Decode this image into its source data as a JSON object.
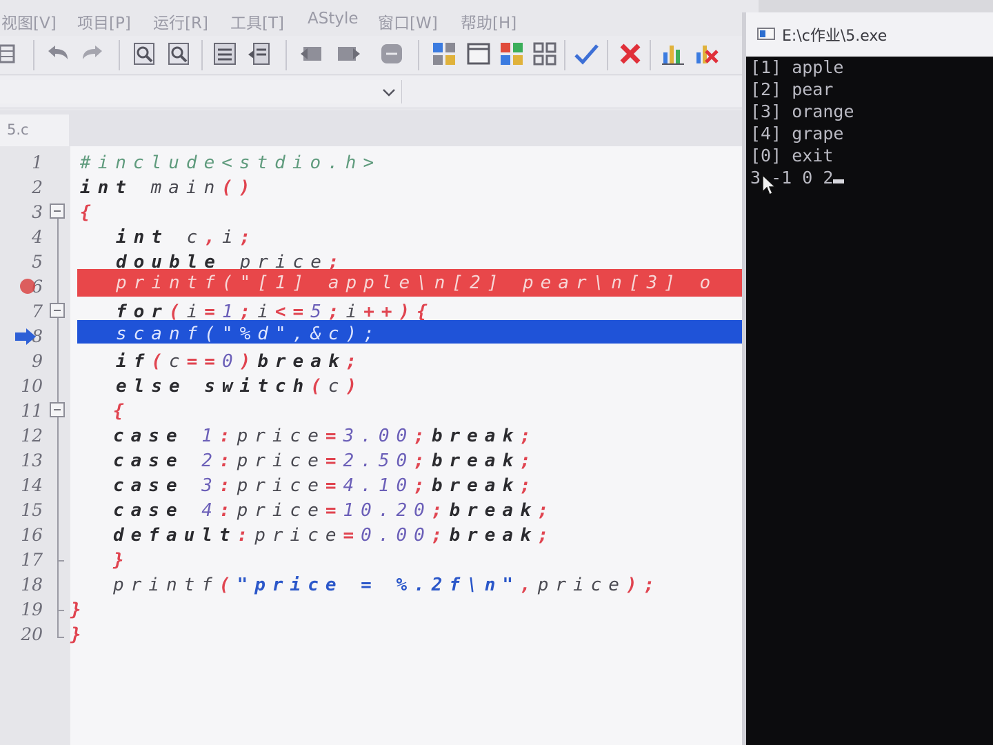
{
  "menu": {
    "items": [
      "视图[V]",
      "项目[P]",
      "运行[R]",
      "工具[T]",
      "AStyle",
      "窗口[W]",
      "帮助[H]"
    ]
  },
  "editor": {
    "file_tab": "5.c",
    "lines": [
      {
        "n": "1"
      },
      {
        "n": "2"
      },
      {
        "n": "3"
      },
      {
        "n": "4"
      },
      {
        "n": "5"
      },
      {
        "n": "6"
      },
      {
        "n": "7"
      },
      {
        "n": "8"
      },
      {
        "n": "9"
      },
      {
        "n": "10"
      },
      {
        "n": "11"
      },
      {
        "n": "12"
      },
      {
        "n": "13"
      },
      {
        "n": "14"
      },
      {
        "n": "15"
      },
      {
        "n": "16"
      },
      {
        "n": "17"
      },
      {
        "n": "18"
      },
      {
        "n": "19"
      },
      {
        "n": "20"
      }
    ],
    "code": {
      "l1": "#include<stdio.h>",
      "l2_kw": "int",
      "l2_rest": " main",
      "l2_paren": "()",
      "l3": "{",
      "l4_kw": "int",
      "l4_rest": " c",
      "l4_op": ",",
      "l4_rest2": "i",
      "l4_semi": ";",
      "l5_kw": "double",
      "l5_rest": " price",
      "l5_semi": ";",
      "l6": "printf(\"[1] apple\\n[2] pear\\n[3] o",
      "l7_kw": "for",
      "l7_p1": "(",
      "l7_a": "i",
      "l7_eq": "=",
      "l7_n1": "1",
      "l7_s1": ";",
      "l7_b": "i",
      "l7_le": "<=",
      "l7_n2": "5",
      "l7_s2": ";",
      "l7_c": "i",
      "l7_inc": "++",
      "l7_p2": "){",
      "l8": "scanf(\"%d\",&c);",
      "l9_kw": "if",
      "l9_p1": "(",
      "l9_c": "c",
      "l9_eq": "==",
      "l9_n": "0",
      "l9_p2": ")",
      "l9_brk": "break",
      "l9_s": ";",
      "l10_kw": "else",
      "l10_sw": " switch",
      "l10_p1": "(",
      "l10_c": "c",
      "l10_p2": ")",
      "l11": "{",
      "l12_case": "case",
      "l12_n": " 1",
      "l12_col": ":",
      "l12_var": "price",
      "l12_eq": "=",
      "l12_val": "3.00",
      "l12_s": ";",
      "l12_brk": "break",
      "l12_s2": ";",
      "l13_case": "case",
      "l13_n": " 2",
      "l13_col": ":",
      "l13_var": "price",
      "l13_eq": "=",
      "l13_val": "2.50",
      "l13_s": ";",
      "l13_brk": "break",
      "l13_s2": ";",
      "l14_case": "case",
      "l14_n": " 3",
      "l14_col": ":",
      "l14_var": "price",
      "l14_eq": "=",
      "l14_val": "4.10",
      "l14_s": ";",
      "l14_brk": "break",
      "l14_s2": ";",
      "l15_case": "case",
      "l15_n": " 4",
      "l15_col": ":",
      "l15_var": "price",
      "l15_eq": "=",
      "l15_val": "10.20",
      "l15_s": ";",
      "l15_brk": "break",
      "l15_s2": ";",
      "l16_def": "default",
      "l16_col": ":",
      "l16_var": "price",
      "l16_eq": "=",
      "l16_val": "0.00",
      "l16_s": ";",
      "l16_brk": "break",
      "l16_s2": ";",
      "l17": "}",
      "l18_fn": "printf",
      "l18_p1": "(",
      "l18_str": "\"price = %.2f\\n\"",
      "l18_com": ",",
      "l18_var": "price",
      "l18_p2": ");",
      "l19": "}",
      "l20": "}"
    }
  },
  "console": {
    "title": "E:\\c作业\\5.exe",
    "lines": [
      "[1] apple",
      "[2] pear",
      "[3] orange",
      "[4] grape",
      "[0] exit"
    ],
    "input": "3 -1 0 2"
  },
  "colors": {
    "breakpoint_line": "#e8474a",
    "execution_line": "#1f53d8",
    "console_bg": "#0c0c0e"
  }
}
